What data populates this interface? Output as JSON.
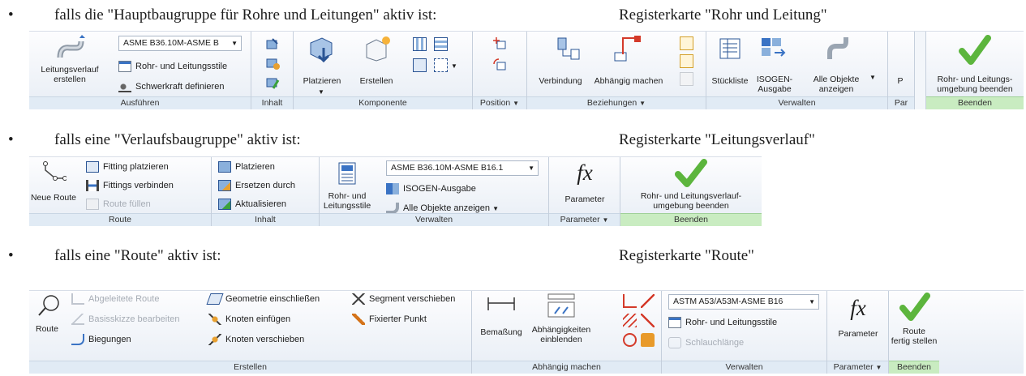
{
  "bullets": [
    {
      "symbol": "•",
      "text": "falls die \"Hauptbaugruppe für Rohre und Leitungen\" aktiv ist:",
      "tab": "Registerkarte \"Rohr und Leitung\""
    },
    {
      "symbol": "•",
      "text": "falls eine \"Verlaufsbaugruppe\" aktiv ist:",
      "tab": "Registerkarte \"Leitungsverlauf\""
    },
    {
      "symbol": "•",
      "text": "falls eine \"Route\" aktiv ist:",
      "tab": "Registerkarte \"Route\""
    }
  ],
  "ribbon1": {
    "ausfuehren": {
      "route_btn": "Leitungsverlauf\nerstellen",
      "style_select": "ASME B36.10M-ASME B",
      "styles": "Rohr- und Leitungsstile",
      "gravity": "Schwerkraft definieren",
      "label": "Ausführen"
    },
    "inhalt": {
      "label": "Inhalt"
    },
    "komponente": {
      "place": "Platzieren",
      "create": "Erstellen",
      "label": "Komponente"
    },
    "position": {
      "label": "Position"
    },
    "beziehungen": {
      "connect": "Verbindung",
      "dependent": "Abhängig machen",
      "label": "Beziehungen"
    },
    "verwalten": {
      "bom": "Stückliste",
      "isogen": "ISOGEN-\nAusgabe",
      "show_all": "Alle Objekte\nanzeigen",
      "label": "Verwalten"
    },
    "param": {
      "short": "P",
      "label": "Par"
    },
    "beenden": {
      "finish": "Rohr- und Leitungs-\numgebung beenden",
      "label": "Beenden"
    }
  },
  "ribbon2": {
    "route": {
      "new_route": "Neue Route",
      "place_fitting": "Fitting platzieren",
      "connect_fittings": "Fittings verbinden",
      "fill_route": "Route füllen",
      "label": "Route"
    },
    "inhalt": {
      "place": "Platzieren",
      "replace": "Ersetzen durch",
      "update": "Aktualisieren",
      "label": "Inhalt"
    },
    "verwalten": {
      "styles": "Rohr- und\nLeitungsstile",
      "style_select": "ASME B36.10M-ASME B16.1",
      "isogen": "ISOGEN-Ausgabe",
      "show_all": "Alle Objekte anzeigen",
      "label": "Verwalten"
    },
    "parameter": {
      "btn": "Parameter",
      "label": "Parameter"
    },
    "beenden": {
      "finish": "Rohr- und Leitungsverlauf-\numgebung beenden",
      "label": "Beenden"
    }
  },
  "ribbon3": {
    "erstellen": {
      "route": "Route",
      "derived": "Abgeleitete Route",
      "edit_sketch": "Basisskizze bearbeiten",
      "bends": "Biegungen",
      "include_geo": "Geometrie einschließen",
      "insert_node": "Knoten einfügen",
      "move_node": "Knoten verschieben",
      "move_segment": "Segment verschieben",
      "fixed_point": "Fixierter Punkt",
      "label": "Erstellen"
    },
    "abhaengig": {
      "dimension": "Bemaßung",
      "show_constraints": "Abhängigkeiten\neinblenden",
      "label": "Abhängig machen"
    },
    "verwalten": {
      "style_select": "ASTM A53/A53M-ASME B16",
      "styles": "Rohr- und Leitungsstile",
      "hose_length": "Schlauchlänge",
      "label": "Verwalten"
    },
    "parameter": {
      "btn": "Parameter",
      "label": "Parameter"
    },
    "beenden": {
      "finish": "Route\nfertig stellen",
      "label": "Beenden"
    }
  },
  "colors": {
    "check": "#5cb53d",
    "group_bar": "#e1ebf5",
    "finish_bar": "#c9ecc1",
    "accent": "#3a73c4"
  }
}
